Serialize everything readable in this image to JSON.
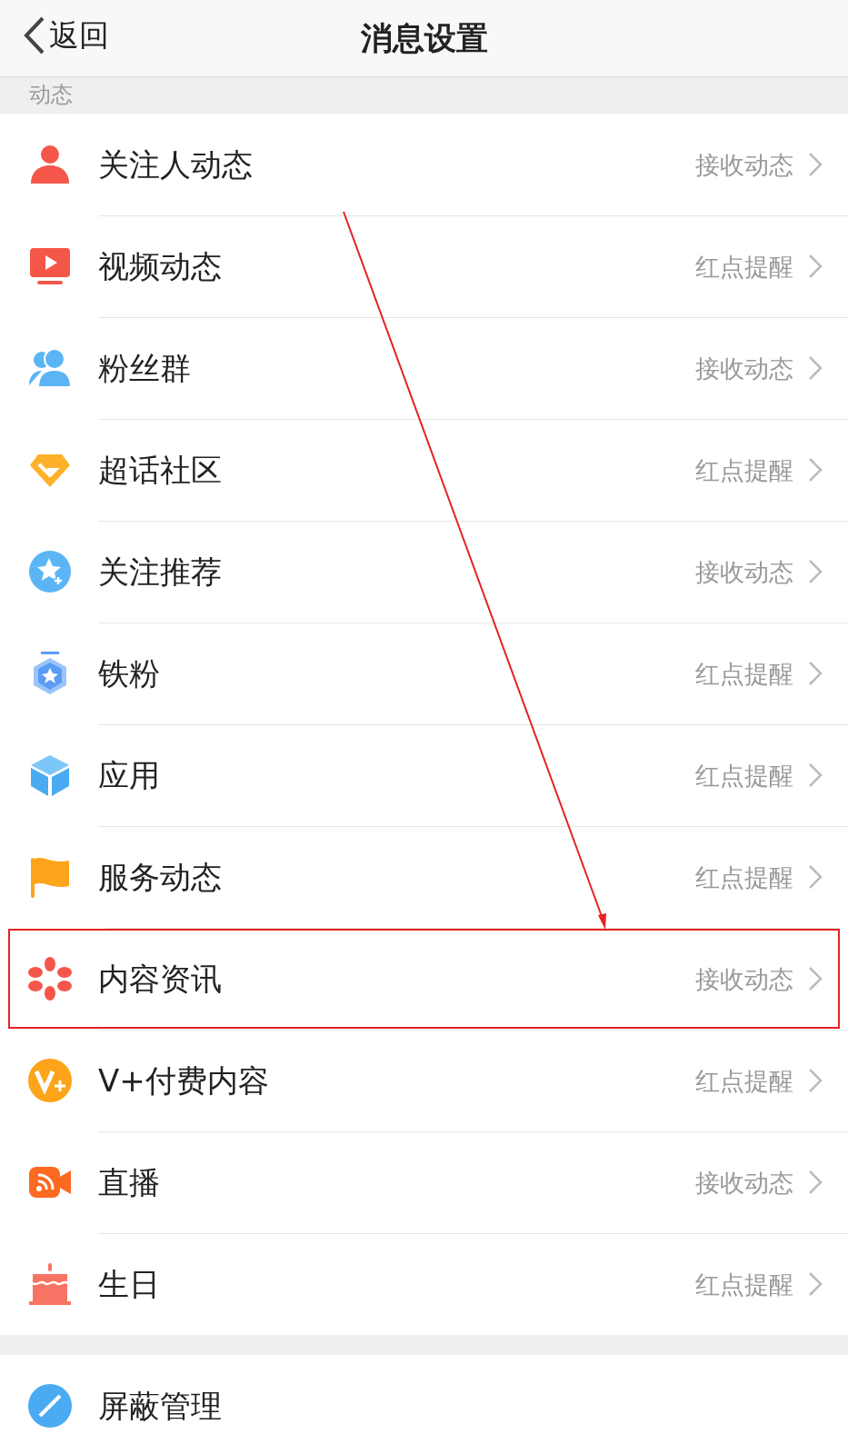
{
  "header": {
    "back": "返回",
    "title": "消息设置"
  },
  "section_label": "动态",
  "rows": [
    {
      "label": "关注人动态",
      "value": "接收动态",
      "highlighted": false
    },
    {
      "label": "视频动态",
      "value": "红点提醒",
      "highlighted": false
    },
    {
      "label": "粉丝群",
      "value": "接收动态",
      "highlighted": false
    },
    {
      "label": "超话社区",
      "value": "红点提醒",
      "highlighted": false
    },
    {
      "label": "关注推荐",
      "value": "接收动态",
      "highlighted": false
    },
    {
      "label": "铁粉",
      "value": "红点提醒",
      "highlighted": false
    },
    {
      "label": "应用",
      "value": "红点提醒",
      "highlighted": false
    },
    {
      "label": "服务动态",
      "value": "红点提醒",
      "highlighted": false
    },
    {
      "label": "内容资讯",
      "value": "接收动态",
      "highlighted": true
    },
    {
      "label": "V+付费内容",
      "value": "红点提醒",
      "highlighted": false
    },
    {
      "label": "直播",
      "value": "接收动态",
      "highlighted": false
    },
    {
      "label": "生日",
      "value": "红点提醒",
      "highlighted": false
    }
  ],
  "bottom_rows": [
    {
      "label": "屏蔽管理"
    }
  ]
}
